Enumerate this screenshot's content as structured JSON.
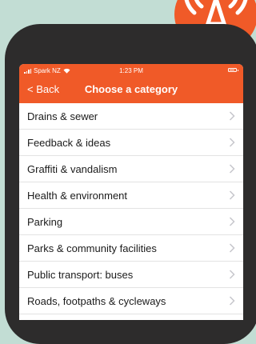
{
  "status_bar": {
    "carrier": "Spark NZ",
    "time": "1:23 PM"
  },
  "nav": {
    "back_label": "< Back",
    "title": "Choose a category"
  },
  "categories": [
    "Drains & sewer",
    "Feedback & ideas",
    "Graffiti & vandalism",
    "Health & environment",
    "Parking",
    "Parks & community facilities",
    "Public transport: buses",
    "Roads, footpaths & cycleways"
  ],
  "colors": {
    "accent": "#f05a28",
    "phone_body": "#2d2c2c",
    "background": "#c2ddd4"
  },
  "icons": {
    "logo": "broadcast-tower-icon",
    "row_disclosure": "chevron-right-icon",
    "signal": "signal-bars-icon",
    "wifi": "wifi-icon",
    "battery": "battery-icon"
  }
}
